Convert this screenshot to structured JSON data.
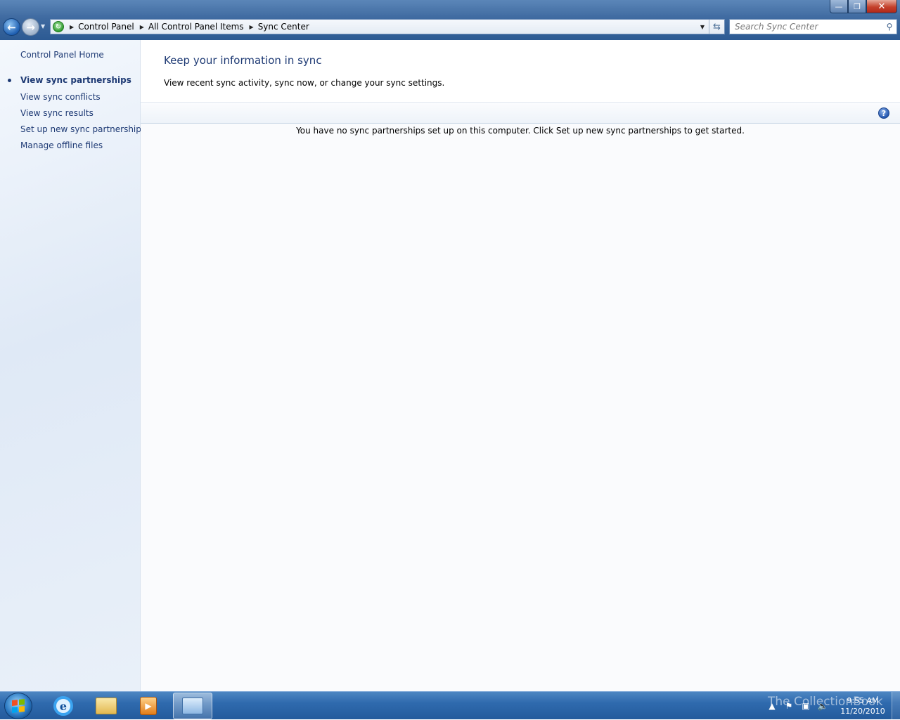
{
  "window": {
    "minimize_glyph": "—",
    "maximize_glyph": "❐",
    "close_glyph": "✕"
  },
  "navigation": {
    "back_glyph": "←",
    "forward_glyph": "→",
    "breadcrumbs": [
      "Control Panel",
      "All Control Panel Items",
      "Sync Center"
    ]
  },
  "search": {
    "placeholder": "Search Sync Center"
  },
  "sidebar": {
    "home_label": "Control Panel Home",
    "items": [
      {
        "label": "View sync partnerships",
        "active": true
      },
      {
        "label": "View sync conflicts",
        "active": false
      },
      {
        "label": "View sync results",
        "active": false
      },
      {
        "label": "Set up new sync partnerships",
        "active": false
      },
      {
        "label": "Manage offline files",
        "active": false
      }
    ]
  },
  "main": {
    "title": "Keep your information in sync",
    "subtitle": "View recent sync activity, sync now, or change your sync settings.",
    "empty_message": "You have no sync partnerships set up on this computer. Click Set up new sync partnerships to get started.",
    "help_glyph": "?"
  },
  "taskbar": {
    "watermark": "The CollectionBook",
    "time": "9:55 AM",
    "date": "11/20/2010"
  },
  "colors": {
    "link": "#1e3a74",
    "taskbar": "#2f6aae",
    "titlebar": "#3f6aa0"
  }
}
